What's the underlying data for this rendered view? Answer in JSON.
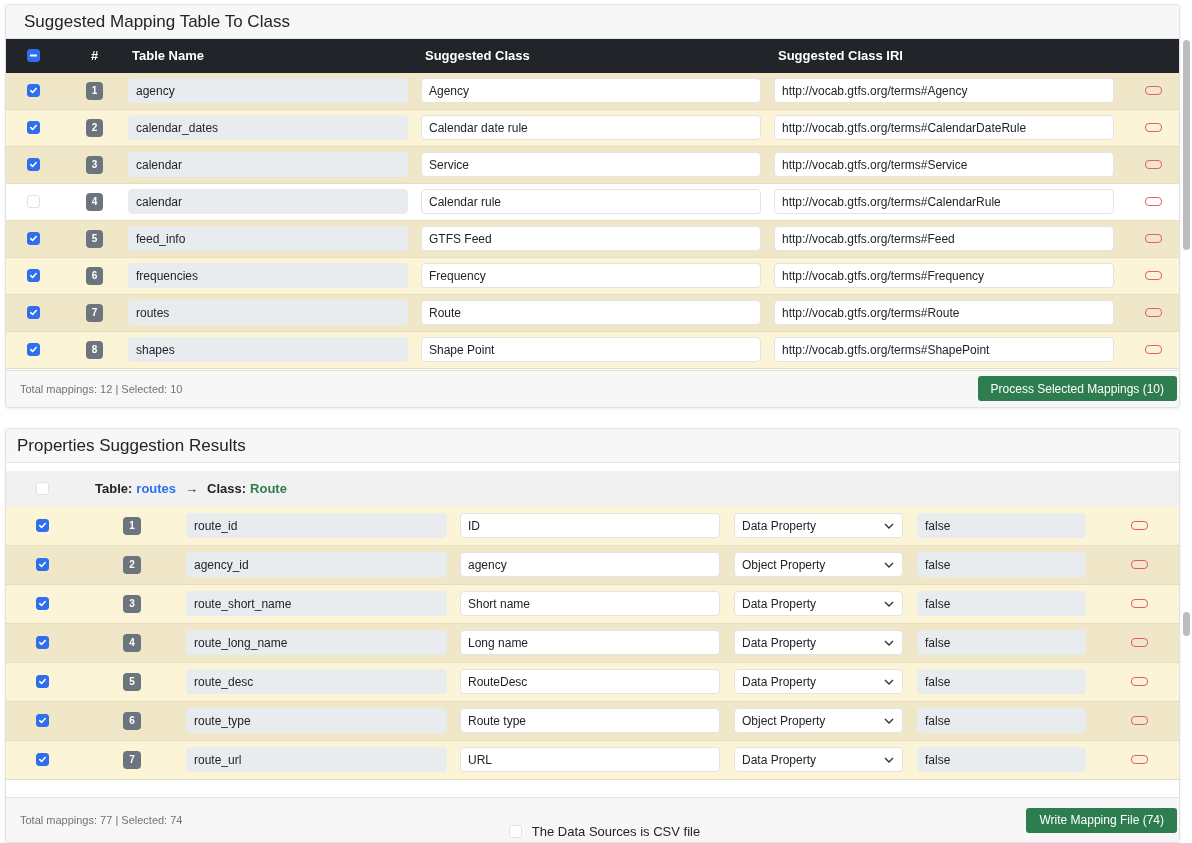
{
  "mapping_panel": {
    "title": "Suggested Mapping Table To Class",
    "select_all": {
      "indeterminate": true
    },
    "columns": [
      "#",
      "Table Name",
      "Suggested Class",
      "Suggested Class IRI"
    ],
    "rows": [
      {
        "number": "1",
        "table_name": "agency",
        "suggested_class": "Agency",
        "class_iri": "http://vocab.gtfs.org/terms#Agency",
        "selected": true
      },
      {
        "number": "2",
        "table_name": "calendar_dates",
        "suggested_class": "Calendar date rule",
        "class_iri": "http://vocab.gtfs.org/terms#CalendarDateRule",
        "selected": true
      },
      {
        "number": "3",
        "table_name": "calendar",
        "suggested_class": "Service",
        "class_iri": "http://vocab.gtfs.org/terms#Service",
        "selected": true
      },
      {
        "number": "4",
        "table_name": "calendar",
        "suggested_class": "Calendar rule",
        "class_iri": "http://vocab.gtfs.org/terms#CalendarRule",
        "selected": false
      },
      {
        "number": "5",
        "table_name": "feed_info",
        "suggested_class": "GTFS Feed",
        "class_iri": "http://vocab.gtfs.org/terms#Feed",
        "selected": true
      },
      {
        "number": "6",
        "table_name": "frequencies",
        "suggested_class": "Frequency",
        "class_iri": "http://vocab.gtfs.org/terms#Frequency",
        "selected": true
      },
      {
        "number": "7",
        "table_name": "routes",
        "suggested_class": "Route",
        "class_iri": "http://vocab.gtfs.org/terms#Route",
        "selected": true
      },
      {
        "number": "8",
        "table_name": "shapes",
        "suggested_class": "Shape Point",
        "class_iri": "http://vocab.gtfs.org/terms#ShapePoint",
        "selected": true
      }
    ],
    "footer": {
      "summary": "Total mappings: 12 | Selected: 10",
      "button": "Process Selected Mappings (10)"
    }
  },
  "properties_panel": {
    "title": "Properties Suggestion Results",
    "group": {
      "checked": false,
      "table_label": "Table:",
      "table": "routes",
      "arrow": "→",
      "class_label": "Class:",
      "class": "Route"
    },
    "rows": [
      {
        "number": "1",
        "column": "route_id",
        "label": "ID",
        "property_type": "Data Property",
        "value": "false",
        "selected": true
      },
      {
        "number": "2",
        "column": "agency_id",
        "label": "agency",
        "property_type": "Object Property",
        "value": "false",
        "selected": true
      },
      {
        "number": "3",
        "column": "route_short_name",
        "label": "Short name",
        "property_type": "Data Property",
        "value": "false",
        "selected": true
      },
      {
        "number": "4",
        "column": "route_long_name",
        "label": "Long name",
        "property_type": "Data Property",
        "value": "false",
        "selected": true
      },
      {
        "number": "5",
        "column": "route_desc",
        "label": "RouteDesc",
        "property_type": "Data Property",
        "value": "false",
        "selected": true
      },
      {
        "number": "6",
        "column": "route_type",
        "label": "Route type",
        "property_type": "Object Property",
        "value": "false",
        "selected": true
      },
      {
        "number": "7",
        "column": "route_url",
        "label": "URL",
        "property_type": "Data Property",
        "value": "false",
        "selected": true
      }
    ],
    "footer": {
      "summary": "Total mappings: 77 | Selected: 74",
      "csv_option": {
        "label": "The Data Sources is CSV file",
        "checked": false
      },
      "button": "Write Mapping File (74)"
    }
  }
}
